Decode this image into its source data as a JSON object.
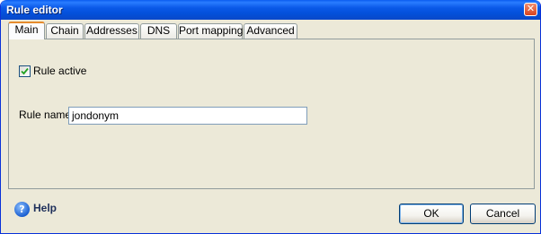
{
  "window": {
    "title": "Rule editor"
  },
  "tabs": [
    {
      "label": "Main"
    },
    {
      "label": "Chain"
    },
    {
      "label": "Addresses"
    },
    {
      "label": "DNS"
    },
    {
      "label": "Port mapping"
    },
    {
      "label": "Advanced"
    }
  ],
  "active_tab": "Main",
  "main": {
    "rule_active": {
      "label": "Rule active",
      "checked": true
    },
    "rule_name": {
      "label": "Rule name",
      "value": "jondonym"
    }
  },
  "footer": {
    "help_icon": "help-icon",
    "help_label": "Help",
    "ok_label": "OK",
    "cancel_label": "Cancel"
  }
}
